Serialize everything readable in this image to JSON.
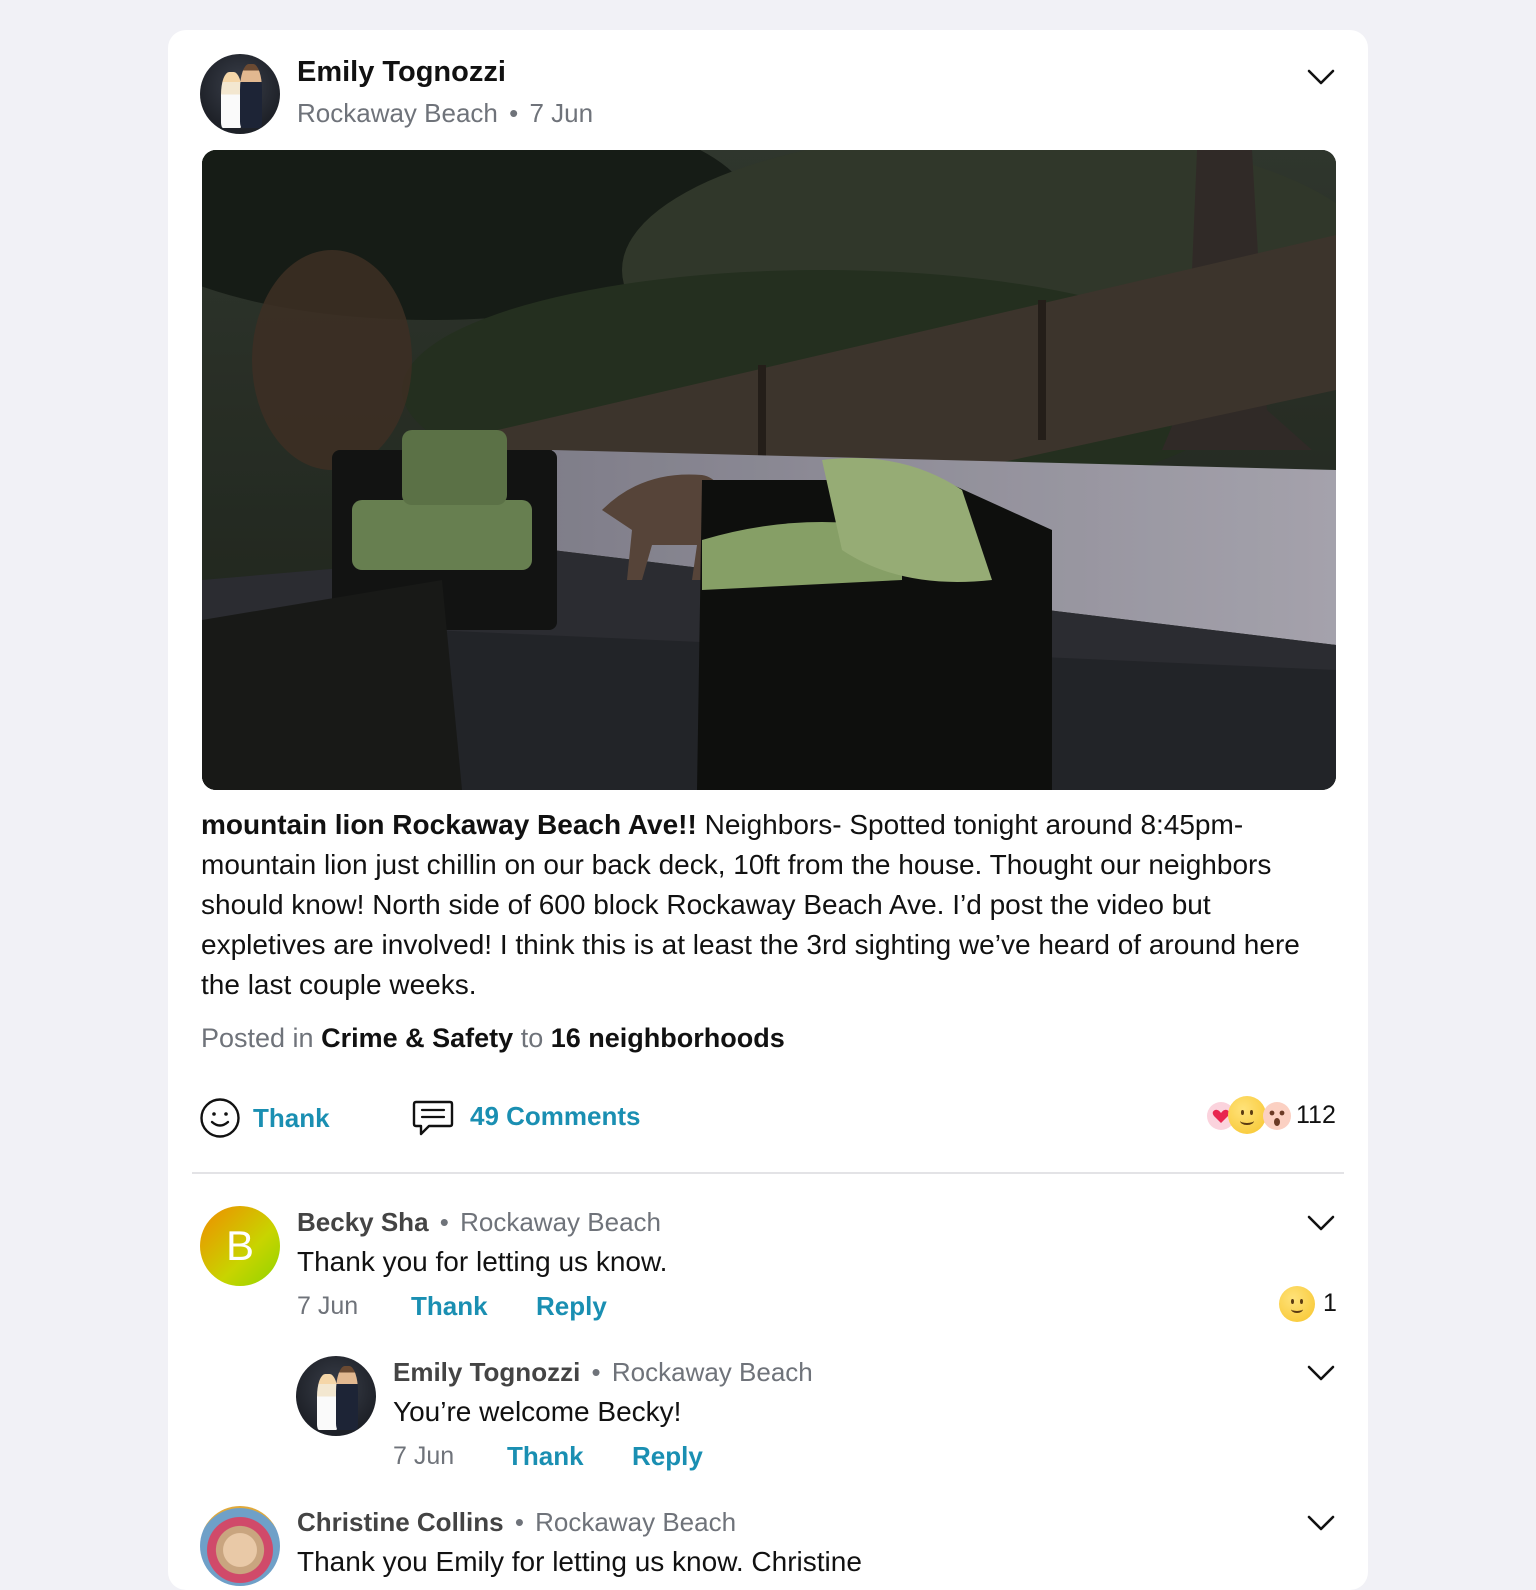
{
  "post": {
    "author": "Emily Tognozzi",
    "location": "Rockaway Beach",
    "separator": "•",
    "date": "7 Jun",
    "title": "mountain lion Rockaway Beach Ave!!",
    "body": "Neighbors- Spotted tonight around 8:45pm- mountain lion just chillin on our back deck, 10ft from the house. Thought our neighbors should know! North side of 600 block Rockaway Beach Ave. I’d post the video but expletives are involved! I think this is at least the 3rd sighting we’ve heard of around here the last couple weeks.",
    "posted_in_label": "Posted in",
    "category": "Crime & Safety",
    "to_label": "to",
    "audience": "16 neighborhoods",
    "thank_label": "Thank",
    "comments_label": "49 Comments",
    "reaction_count": "112",
    "icons": {
      "menu": "chevron-down-icon",
      "thank": "smiley-outline-icon",
      "comments": "speech-bubble-icon",
      "reactions": [
        "heart-emoji",
        "smile-emoji",
        "surprised-emoji"
      ]
    }
  },
  "comments": [
    {
      "author": "Becky Sha",
      "location": "Rockaway Beach",
      "avatar_letter": "B",
      "text": "Thank you for letting us know.",
      "date": "7 Jun",
      "thank_label": "Thank",
      "reply_label": "Reply",
      "reaction_count": "1"
    },
    {
      "author": "Emily Tognozzi",
      "location": "Rockaway Beach",
      "text": "You’re welcome Becky!",
      "date": "7 Jun",
      "thank_label": "Thank",
      "reply_label": "Reply"
    },
    {
      "author": "Christine Collins",
      "location": "Rockaway Beach",
      "text": "Thank you Emily for letting us know.  Christine"
    }
  ],
  "colors": {
    "accent": "#1a8fb2",
    "muted": "#6f737a",
    "background": "#f1f1f6"
  }
}
